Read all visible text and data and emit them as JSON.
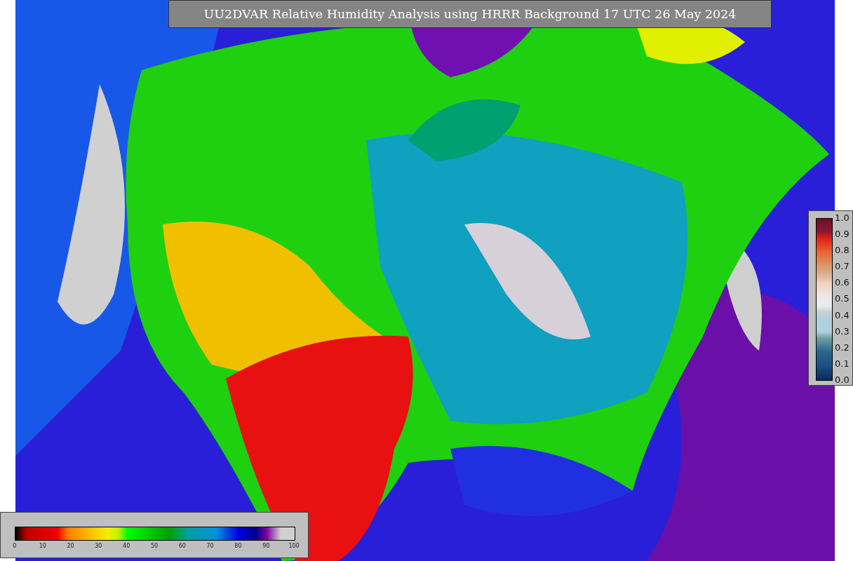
{
  "title": "UU2DVAR Relative Humidity Analysis using HRRR Background 17 UTC 26 May 2024",
  "colorbar_horizontal": {
    "ticks": [
      "0",
      "10",
      "20",
      "30",
      "40",
      "50",
      "60",
      "70",
      "80",
      "90",
      "100"
    ]
  },
  "colorbar_vertical": {
    "ticks": [
      "1.0",
      "0.9",
      "0.8",
      "0.7",
      "0.6",
      "0.5",
      "0.4",
      "0.3",
      "0.2",
      "0.1",
      "0.0"
    ]
  }
}
